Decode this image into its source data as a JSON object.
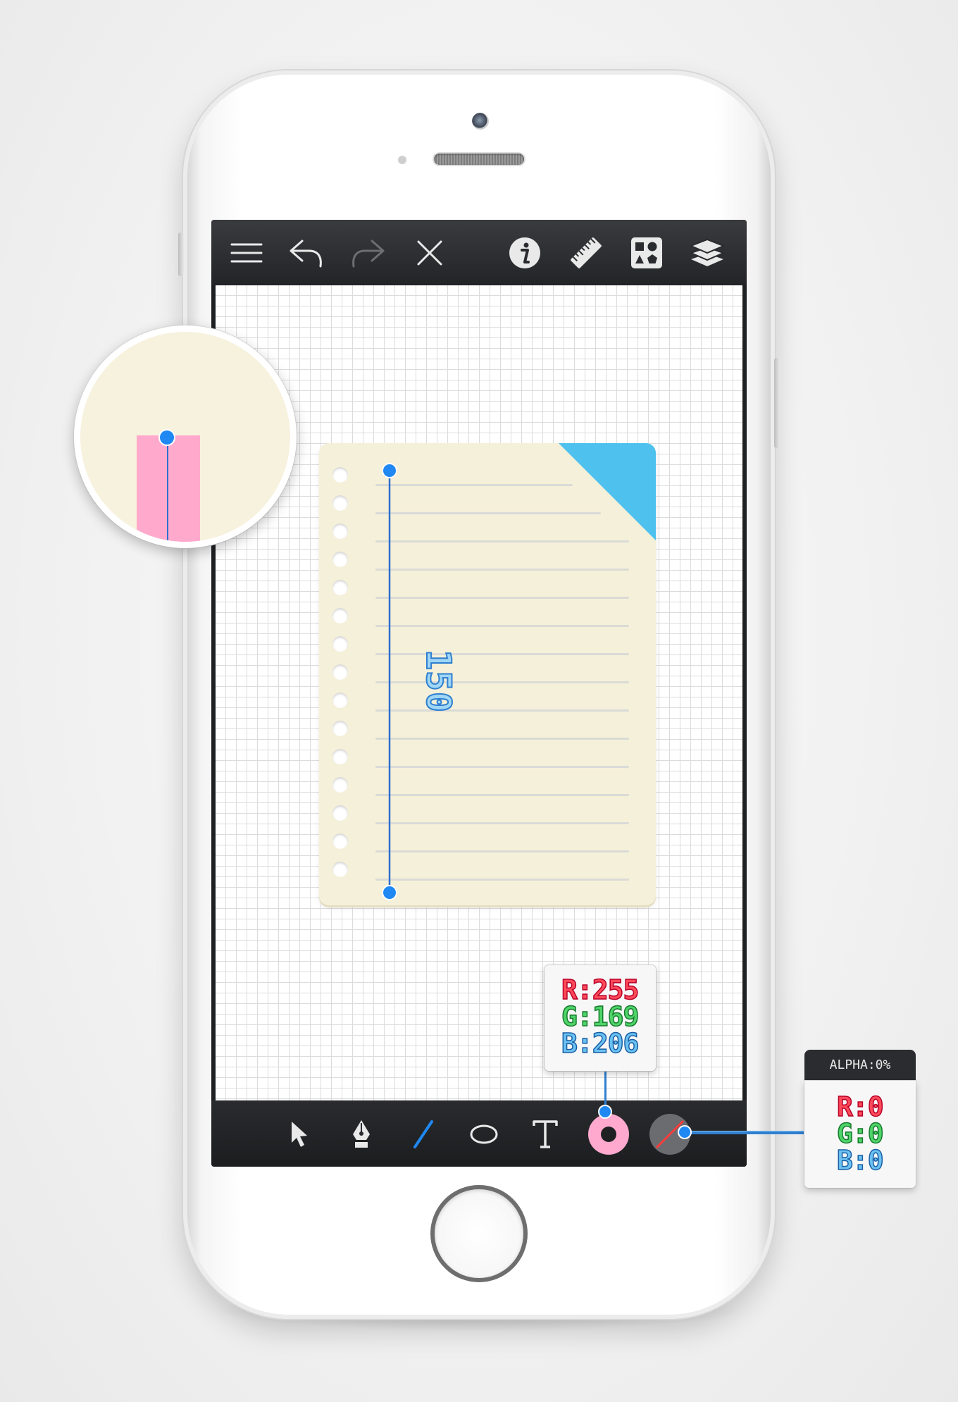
{
  "top_toolbar": {
    "items": [
      {
        "name": "menu-icon"
      },
      {
        "name": "undo-icon"
      },
      {
        "name": "redo-icon"
      },
      {
        "name": "close-icon"
      },
      {
        "name": "info-icon"
      },
      {
        "name": "ruler-icon"
      },
      {
        "name": "shapes-library-icon"
      },
      {
        "name": "layers-icon"
      }
    ]
  },
  "canvas": {
    "measurement_label": "150",
    "artwork": {
      "paper_color": "#F5F0D9",
      "corner_color": "#4EC1EE",
      "hole_count": 15,
      "ruled_line_count": 15
    }
  },
  "magnifier": {
    "fill_color": "#FFAACD",
    "line_color": "#2F6FCF"
  },
  "bottom_toolbar": {
    "items": [
      {
        "name": "select-arrow-icon"
      },
      {
        "name": "pen-tool-icon"
      },
      {
        "name": "line-tool-icon"
      },
      {
        "name": "ellipse-tool-icon"
      },
      {
        "name": "text-tool-icon"
      },
      {
        "name": "fill-color-swatch",
        "color": "#FFA9CE"
      },
      {
        "name": "stroke-color-swatch",
        "color": "none"
      }
    ]
  },
  "fill_color_popup": {
    "r": "R:255",
    "g": "G:169",
    "b": "B:206"
  },
  "stroke_color_popup": {
    "alpha": "ALPHA:0%",
    "r": "R:0",
    "g": "G:0",
    "b": "B:0"
  }
}
